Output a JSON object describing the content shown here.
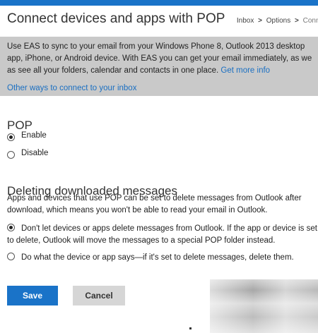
{
  "header": {
    "title": "Connect devices and apps with POP",
    "breadcrumb": [
      "Inbox",
      "Options",
      "Connect de"
    ],
    "breadcrumb_separator": ">"
  },
  "info": {
    "line1": "Use EAS to sync to your email from your Windows Phone 8, Outlook 2013 desktop",
    "line2": "app, iPhone, or Android device. With EAS you can get your email immediately, as we",
    "line3": "as see all your folders, calendar and contacts in one place.",
    "get_more_info": "Get more info",
    "other_ways": "Other ways to connect to your inbox"
  },
  "pop": {
    "heading": "POP",
    "options": [
      {
        "label": "Enable",
        "checked": true
      },
      {
        "label": "Disable",
        "checked": false
      }
    ]
  },
  "deleting": {
    "heading": "Deleting downloaded messages",
    "description": "Apps and devices that use POP can be set to delete messages from Outlook after download, which means you won't be able to read your email in Outlook.",
    "option1": "Don't let devices or apps delete messages from Outlook. If the app or device is set to delete, Outlook will move the messages to a special POP folder instead.",
    "option2": "Do what the device or app says—if it's set to delete messages, delete them."
  },
  "buttons": {
    "save": "Save",
    "cancel": "Cancel"
  },
  "colors": {
    "accent": "#1a73c8",
    "link": "#1a6fc2",
    "panel": "#c9c9c9"
  }
}
